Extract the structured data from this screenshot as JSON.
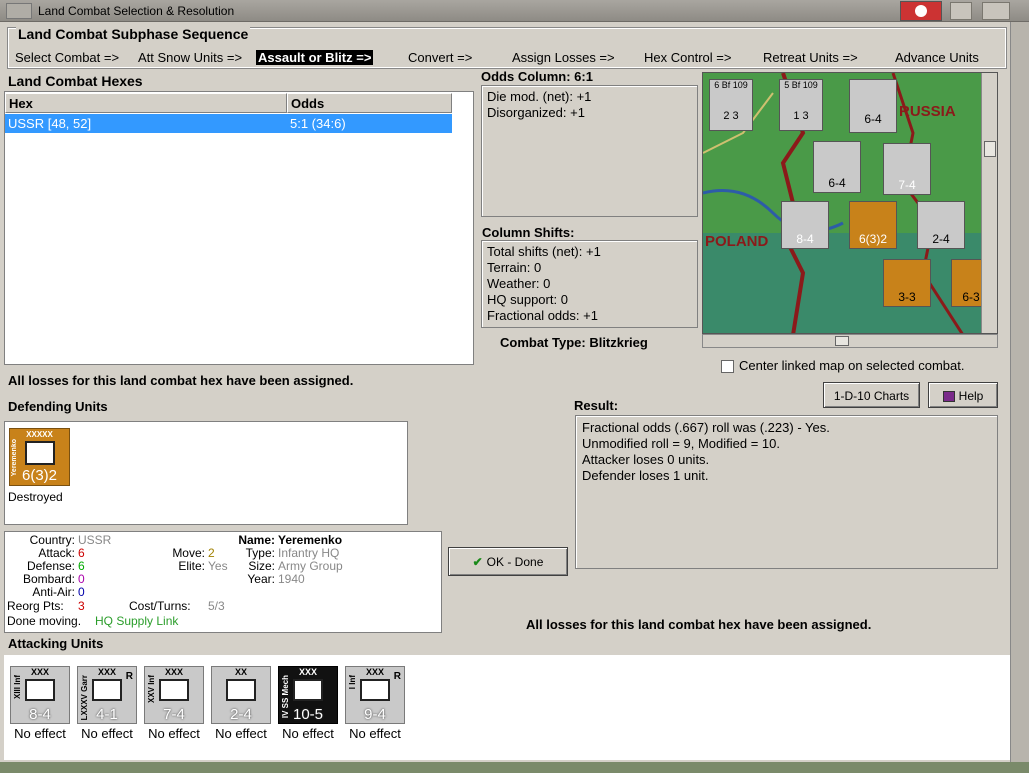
{
  "window": {
    "title": "Land Combat Selection & Resolution"
  },
  "sequence": {
    "title": "Land Combat Subphase Sequence",
    "steps": [
      "Select Combat =>",
      "Att Snow Units =>",
      "Assault or Blitz =>",
      "Convert =>",
      "Assign Losses =>",
      "Hex Control =>",
      "Retreat Units =>",
      "Advance Units"
    ],
    "active_index": 2
  },
  "hexes": {
    "title": "Land Combat Hexes",
    "col_hex": "Hex",
    "col_odds": "Odds",
    "rows": [
      {
        "hex": "USSR [48, 52]",
        "odds": "5:1 (34:6)"
      }
    ]
  },
  "odds": {
    "title": "Odds Column: 6:1",
    "lines": [
      "Die mod. (net): +1",
      "Disorganized: +1"
    ]
  },
  "shifts": {
    "title": "Column Shifts:",
    "lines": [
      "Total shifts (net): +1",
      "Terrain: 0",
      "Weather: 0",
      "HQ support: 0",
      "Fractional odds: +1"
    ]
  },
  "combat_type": "Combat Type:  Blitzkrieg",
  "center_map_label": "Center linked map on selected combat.",
  "losses_msg": "All losses for this land combat hex have been assigned.",
  "defending": {
    "title": "Defending Units",
    "unit": {
      "name": "Yeremenko",
      "size": "XXXXX",
      "value": "6(3)2",
      "status": "Destroyed"
    }
  },
  "result": {
    "title": "Result:",
    "lines": [
      "Fractional odds (.667) roll was (.223)  - Yes.",
      "Unmodified roll = 9, Modified = 10.",
      "Attacker loses 0 units.",
      "Defender loses 1 unit."
    ]
  },
  "buttons": {
    "charts": "1-D-10 Charts",
    "help": "Help",
    "ok": "OK - Done"
  },
  "info": {
    "country_label": "Country:",
    "country": "USSR",
    "attack_label": "Attack:",
    "attack": "6",
    "defense_label": "Defense:",
    "defense": "6",
    "bombard_label": "Bombard:",
    "bombard": "0",
    "antiair_label": "Anti-Air:",
    "antiair": "0",
    "reorg_label": "Reorg Pts:",
    "reorg": "3",
    "move_label": "Move:",
    "move": "2",
    "elite_label": "Elite:",
    "elite": "Yes",
    "cost_label": "Cost/Turns:",
    "cost": "5/3",
    "name_label": "Name:",
    "name": "Yeremenko",
    "type_label": "Type:",
    "type": "Infantry HQ",
    "size_label": "Size:",
    "size": "Army Group",
    "year_label": "Year:",
    "year": "1940",
    "done_moving": "Done moving.",
    "supply": "HQ Supply Link"
  },
  "attacking": {
    "title": "Attacking Units",
    "units": [
      {
        "side": "XIII Inf",
        "size": "XXX",
        "value": "8-4",
        "result": "No effect"
      },
      {
        "side": "LXXXV Garr",
        "size": "XXX",
        "value": "4-1",
        "result": "No effect",
        "reserve": "R"
      },
      {
        "side": "XXV Inf",
        "size": "XXX",
        "value": "7-4",
        "result": "No effect"
      },
      {
        "side": "",
        "size": "XX",
        "value": "2-4",
        "result": "No effect"
      },
      {
        "side": "IV SS Mech",
        "size": "XXX",
        "value": "10-5",
        "result": "No effect"
      },
      {
        "side": "I Inf",
        "size": "XXX",
        "value": "9-4",
        "result": "No effect",
        "reserve": "R"
      }
    ]
  },
  "map": {
    "labels": {
      "russia": "RUSSIA",
      "poland": "POLAND"
    },
    "counters": [
      {
        "value": "6-4"
      },
      {
        "value": "7-4"
      },
      {
        "value": "8-4"
      },
      {
        "value": "6(3)2"
      },
      {
        "value": "2-4"
      },
      {
        "value": "3-3"
      },
      {
        "value": "6-3"
      },
      {
        "value": "6-4"
      }
    ],
    "air": [
      {
        "top": "6  Bf 109",
        "bottom": "2   3"
      },
      {
        "top": "5  Bf 109",
        "bottom": "1   3"
      }
    ]
  },
  "colors": {
    "bg": "#d4d0c8",
    "selection": "#3399ff",
    "hq_counter": "#c8821a",
    "german_counter": "#c9c9c9"
  }
}
